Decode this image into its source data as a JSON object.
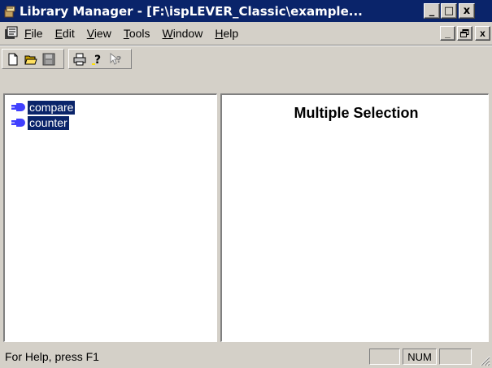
{
  "window": {
    "title": "Library Manager - [F:\\ispLEVER_Classic\\example...",
    "minimize": "_",
    "maximize": "□",
    "close": "x",
    "title_bar_color": "#0a246a"
  },
  "menubar": {
    "items": [
      {
        "first": "F",
        "rest": "ile"
      },
      {
        "first": "E",
        "rest": "dit"
      },
      {
        "first": "V",
        "rest": "iew"
      },
      {
        "first": "T",
        "rest": "ools"
      },
      {
        "first": "W",
        "rest": "indow"
      },
      {
        "first": "H",
        "rest": "elp"
      }
    ],
    "doc_minimize": "_",
    "doc_close": "x"
  },
  "toolbar": {
    "buttons": [
      "new-icon",
      "open-icon",
      "save-icon",
      "print-icon",
      "help-icon",
      "context-help-icon"
    ]
  },
  "tree": {
    "items": [
      {
        "label": "compare",
        "icon": "module-icon"
      },
      {
        "label": "counter",
        "icon": "module-icon"
      }
    ],
    "selection_color": "#0a246a"
  },
  "detail": {
    "title": "Multiple Selection"
  },
  "statusbar": {
    "help_text": "For Help, press F1",
    "num_indicator": "NUM"
  }
}
